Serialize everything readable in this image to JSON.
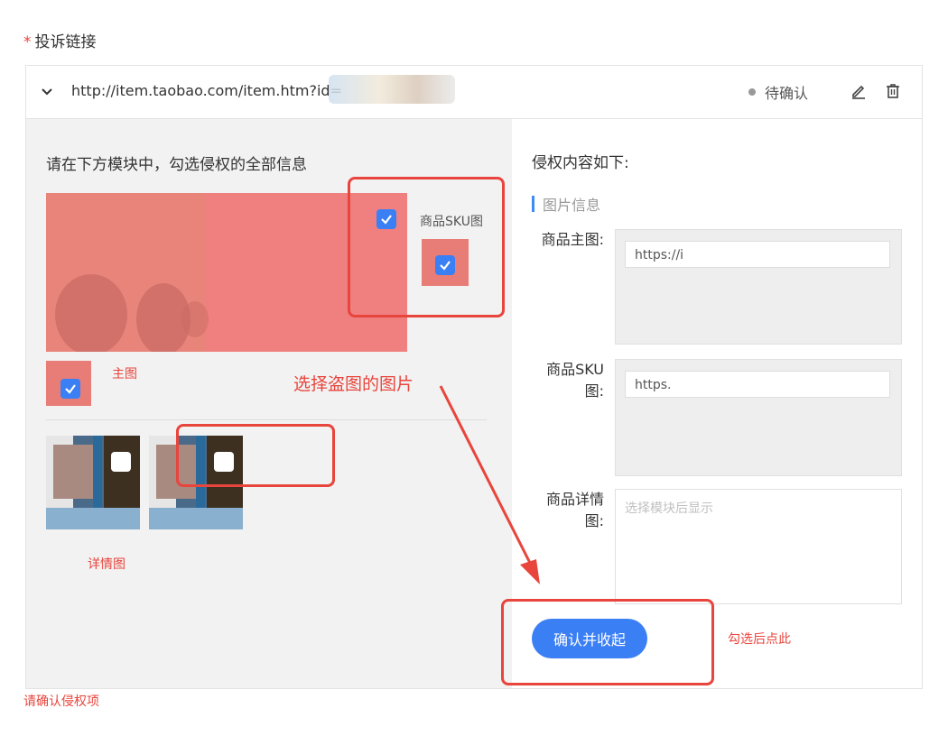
{
  "field": {
    "required_mark": "*",
    "label": "投诉链接"
  },
  "link": {
    "url": "http://item.taobao.com/item.htm?id=",
    "status": "待确认"
  },
  "left": {
    "instruction": "请在下方模块中，勾选侵权的全部信息",
    "main_label": "主图",
    "sku_label": "商品SKU图",
    "detail_label": "详情图"
  },
  "right": {
    "title": "侵权内容如下:",
    "section": "图片信息",
    "main_img_label": "商品主图:",
    "main_img_value": "https://i",
    "sku_label_line1": "商品SKU",
    "sku_label_line2": "图:",
    "sku_value": "https.",
    "detail_label_line1": "商品详情",
    "detail_label_line2": "图:",
    "detail_placeholder": "选择模块后显示",
    "confirm_button": "确认并收起"
  },
  "annotations": {
    "select_stolen": "选择盗图的图片",
    "click_here": "勾选后点此"
  },
  "error": "请确认侵权项",
  "colors": {
    "accent": "#3b7ff5",
    "annotation": "#e8453c"
  }
}
